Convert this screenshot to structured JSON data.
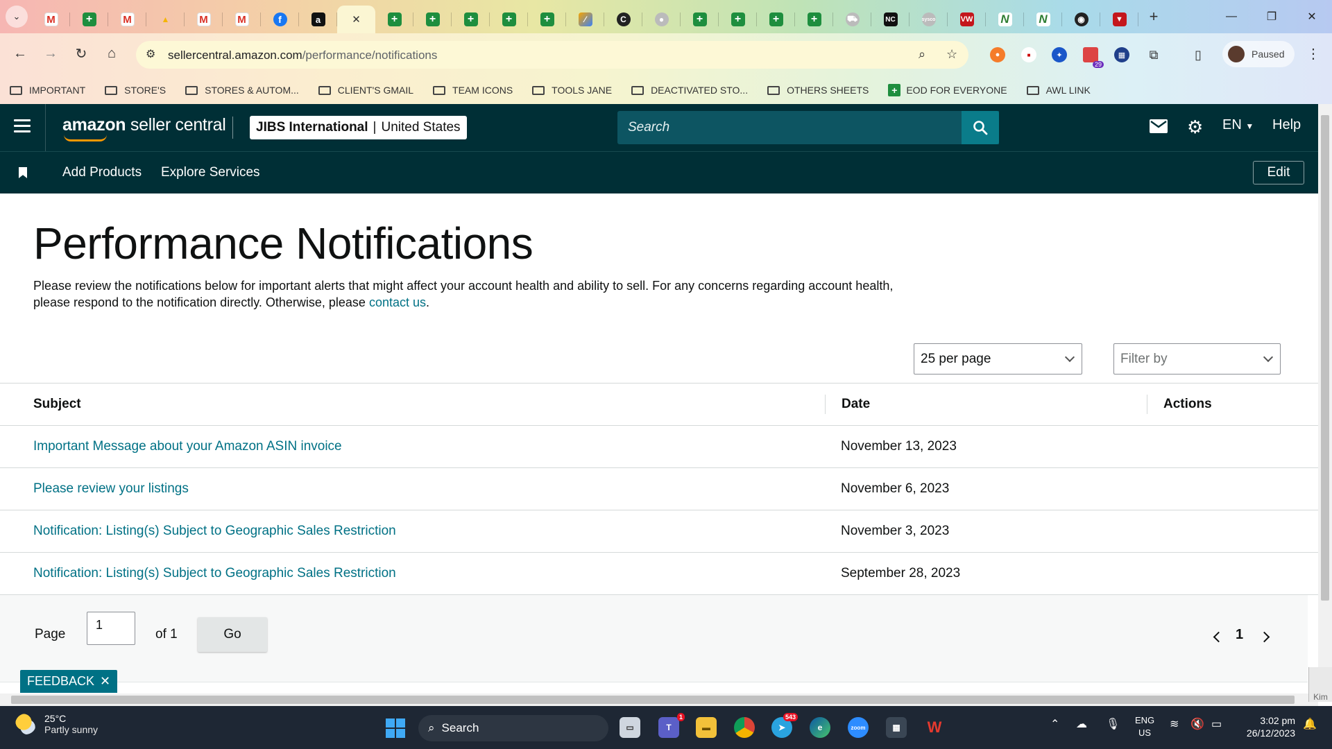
{
  "browser": {
    "tabs": [
      {
        "icon": "gmail-icon",
        "glyph": "M"
      },
      {
        "icon": "sheets-icon",
        "glyph": "+"
      },
      {
        "icon": "gmail-icon",
        "glyph": "M"
      },
      {
        "icon": "drive-icon",
        "glyph": "▲"
      },
      {
        "icon": "gmail-icon",
        "glyph": "M"
      },
      {
        "icon": "gmail-icon",
        "glyph": "M"
      },
      {
        "icon": "facebook-icon",
        "glyph": "f"
      },
      {
        "icon": "amazon-icon",
        "glyph": "a"
      },
      {
        "icon": "close-icon",
        "glyph": "✕",
        "active": true
      },
      {
        "icon": "sheets-icon",
        "glyph": "+"
      },
      {
        "icon": "sheets-icon",
        "glyph": "+"
      },
      {
        "icon": "sheets-icon",
        "glyph": "+"
      },
      {
        "icon": "sheets-icon",
        "glyph": "+"
      },
      {
        "icon": "sheets-icon",
        "glyph": "+"
      },
      {
        "icon": "tool-icon",
        "glyph": "⁄"
      },
      {
        "icon": "circle-c-icon",
        "glyph": "C"
      },
      {
        "icon": "grey-globe-icon",
        "glyph": "●"
      },
      {
        "icon": "sheets-icon",
        "glyph": "+"
      },
      {
        "icon": "sheets-icon",
        "glyph": "+"
      },
      {
        "icon": "sheets-icon",
        "glyph": "+"
      },
      {
        "icon": "sheets-icon",
        "glyph": "+"
      },
      {
        "icon": "car-icon",
        "glyph": "⛟"
      },
      {
        "icon": "nc-icon",
        "glyph": "NC"
      },
      {
        "icon": "sysco-icon",
        "glyph": "sysco"
      },
      {
        "icon": "vw-icon",
        "glyph": "VW"
      },
      {
        "icon": "n-icon",
        "glyph": "N"
      },
      {
        "icon": "n-icon",
        "glyph": "N"
      },
      {
        "icon": "badge-icon",
        "glyph": "◉"
      },
      {
        "icon": "shield-icon",
        "glyph": "▼"
      }
    ],
    "new_tab": "+",
    "url_host": "sellercentral.amazon.com",
    "url_path": "/performance/notifications",
    "profile_status": "Paused",
    "ext_badge": "29",
    "bookmarks": [
      {
        "label": "IMPORTANT",
        "type": "folder"
      },
      {
        "label": "STORE'S",
        "type": "folder"
      },
      {
        "label": "STORES & AUTOM...",
        "type": "folder"
      },
      {
        "label": "CLIENT'S GMAIL",
        "type": "folder"
      },
      {
        "label": "TEAM ICONS",
        "type": "folder"
      },
      {
        "label": "TOOLS JANE",
        "type": "folder"
      },
      {
        "label": "DEACTIVATED STO...",
        "type": "folder"
      },
      {
        "label": "OTHERS SHEETS",
        "type": "folder"
      },
      {
        "label": "EOD FOR EVERYONE",
        "type": "sheet"
      },
      {
        "label": "AWL LINK",
        "type": "folder"
      }
    ]
  },
  "header": {
    "logo_main": "amazon",
    "logo_sub": " seller central",
    "account_name": "JIBS International",
    "account_sep": "|",
    "account_region": "United States",
    "search_placeholder": "Search",
    "lang": "EN",
    "help": "Help"
  },
  "nav": {
    "links": [
      "Add Products",
      "Explore Services"
    ],
    "edit": "Edit"
  },
  "page": {
    "title": "Performance Notifications",
    "intro_text": "Please review the notifications below for important alerts that might affect your account health and ability to sell. For any concerns regarding account health, please respond to the notification directly. Otherwise, please ",
    "intro_link": "contact us",
    "intro_end": ".",
    "per_page": "25 per page",
    "filter_placeholder": "Filter by"
  },
  "table": {
    "headers": {
      "subject": "Subject",
      "date": "Date",
      "actions": "Actions"
    },
    "rows": [
      {
        "subject": "Important Message about your Amazon ASIN invoice",
        "date": "November 13, 2023"
      },
      {
        "subject": "Please review your listings",
        "date": "November 6, 2023"
      },
      {
        "subject": "Notification: Listing(s) Subject to Geographic Sales Restriction",
        "date": "November 3, 2023"
      },
      {
        "subject": "Notification: Listing(s) Subject to Geographic Sales Restriction",
        "date": "September 28, 2023"
      }
    ]
  },
  "pager": {
    "page_label": "Page",
    "page_value": "1",
    "of_label": "of 1",
    "go": "Go",
    "current": "1"
  },
  "feedback": {
    "label": "FEEDBACK",
    "close": "✕"
  },
  "scroll_corner": "Kim",
  "taskbar": {
    "temp": "25°C",
    "weather": "Partly sunny",
    "search": "Search",
    "teams_badge": "1",
    "telegram_badge": "543",
    "lang_1": "ENG",
    "lang_2": "US",
    "time": "3:02 pm",
    "date": "26/12/2023"
  }
}
